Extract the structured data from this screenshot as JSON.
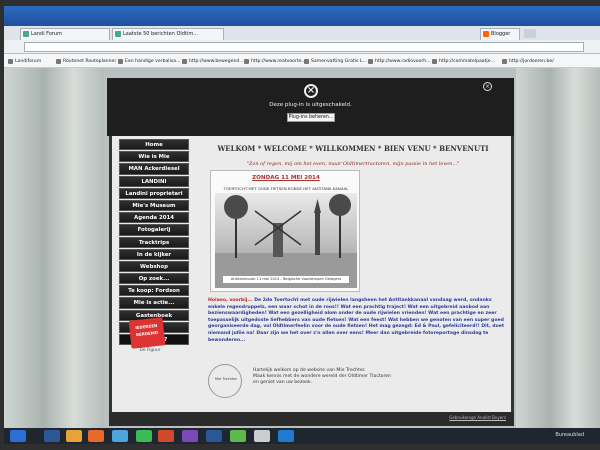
{
  "browser": {
    "tabs": [
      {
        "label": "Landi Forum"
      },
      {
        "label": "Laatste 50 berichten Oldtim..."
      },
      {
        "label": "Blogger"
      }
    ],
    "bookmarks": [
      {
        "label": "Landiforum"
      },
      {
        "label": "Routenet Routeplanner"
      },
      {
        "label": "Een handige verbalisa..."
      },
      {
        "label": "http://www.bewegend..."
      },
      {
        "label": "http://www.reatvoorte..."
      },
      {
        "label": "Samenvatting Gratis L..."
      },
      {
        "label": "http://www.radiovoorh..."
      },
      {
        "label": "http://commatelpaatje..."
      },
      {
        "label": "http://jordoeren.be/"
      }
    ]
  },
  "plugin": {
    "message": "Deze plug-in is uitgeschakeld.",
    "button": "Plug-ins beheren..."
  },
  "site": {
    "welcome": "WELKOM * WELCOME * WILLKOMMEN * BIEN VENU * BENVENUTI",
    "quote": "\"Zon of regen, mij om het even, maar Oldtimertractoren, mijn passie in het leven...\"",
    "menu": [
      "Home",
      "Wie is Mie",
      "MAN Ackerdiesel",
      "LANDINI",
      "Landini proprietari",
      "Mie's Museum",
      "Agenda 2014",
      "Fotogalerij",
      "Tracktrips",
      "In de kijker",
      "Webshop",
      "Op zoek...",
      "Te koop: Fordson",
      "Mie is actie...",
      "Gastenboek",
      "E-mail",
      "18:40:37"
    ],
    "logo_text": "IEDEREEN BEROEMD",
    "logo_caption": "De Figuur",
    "photo_date": "ZONDAG 11 MEI 2014",
    "photo_caption": "TOERTOCHT MET OUDE FIETSEN RONDE HET ANTITANK KANAAL",
    "photo_banner": "Antitankroute 11 mei 2014 - Belgische Voorkempen Gelegers",
    "body_lead": "Hoiaoo, voorbij...",
    "body_text": "De 2de Toertocht met oude rijwielen langsheen het Antitankkanaal vandaag werd, ondanks enkele regendruppels, een waar schot in de roos!! Wat een prachtig traject! Wat een uitgebreid aanbod aan bezienswaardigheden! Wat een gezelligheid alom onder de oude rijwielen vrienden! Wat een prachtige en zeer toepasselijk uitgedoste liefhebbers van oude fietsen! Wat een feest! Wat hebben we genoten van een super goed georganiseerde dag, vol Oldtimerfeelin voor de oude fietsen! Het mag gezegd: Ed & Paul, gefeliciteerd!! Dit, doet niemand jullie na! Daar zijn we het over z'n allen over eens! Meer dan uitgebreide fotoreportage dinsdag te bewonderen...",
    "stamp_text": "Mie Trechter",
    "footer_line1": "Hartelijk welkom op de website van Mie Trechter.",
    "footer_line2": "Maak kennis met de wondere wereld der Oldtimer Tractoren",
    "footer_line3": "en geniet van uw bezoek.",
    "bottom_link": "Gebruikersge Analist Buyers"
  },
  "taskbar": {
    "tray_label": "Bureaublad"
  }
}
